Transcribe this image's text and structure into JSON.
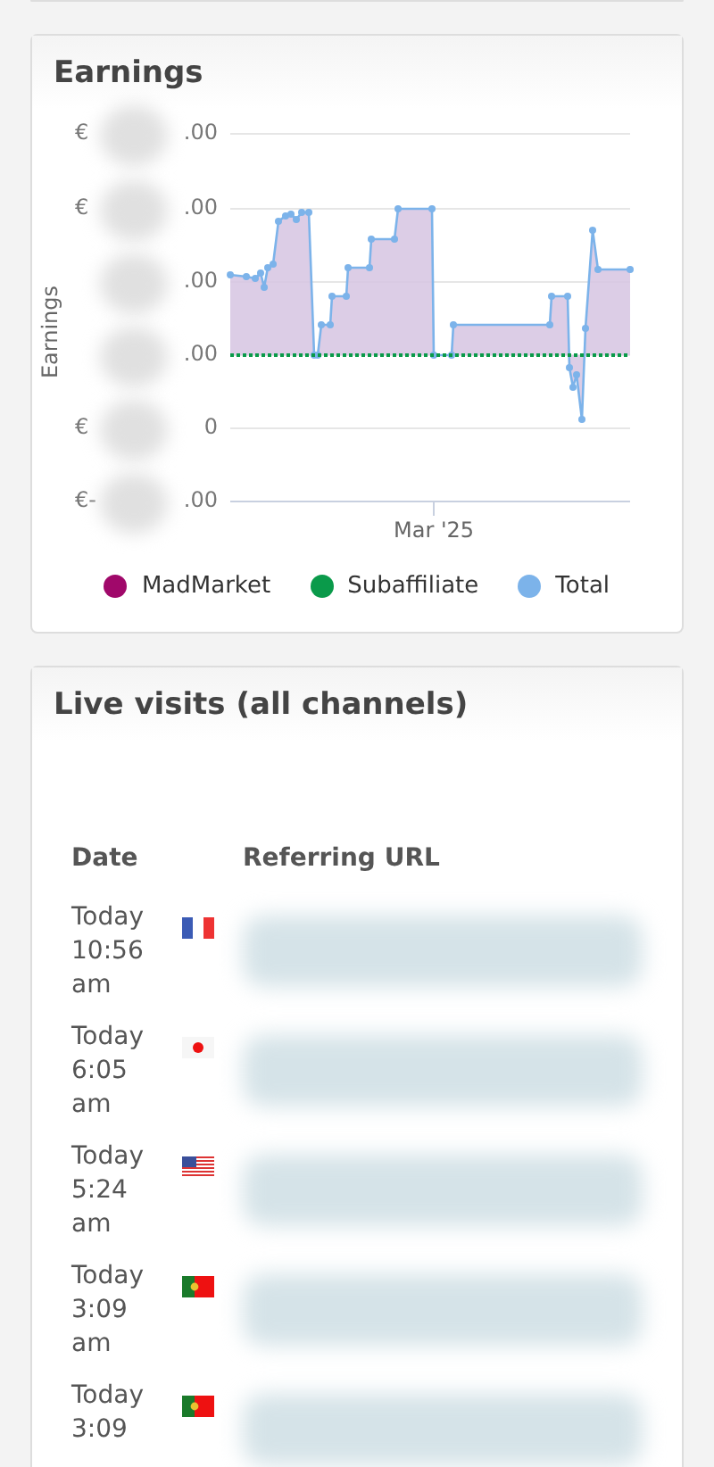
{
  "earnings": {
    "title": "Earnings",
    "ylabel": "Earnings",
    "y_labels": [
      {
        "prefix": "€",
        "suffix": ".00"
      },
      {
        "prefix": "€",
        "suffix": ".00"
      },
      {
        "suffix": ".00"
      },
      {
        "suffix": ".00"
      },
      {
        "prefix": "€",
        "suffix": "0"
      },
      {
        "prefix": "€-",
        "suffix": ".00"
      }
    ],
    "x_label": "Mar '25",
    "legend": [
      {
        "label": "MadMarket",
        "color": "#a0086a"
      },
      {
        "label": "Subaffiliate",
        "color": "#0a9a4a"
      },
      {
        "label": "Total",
        "color": "#7cb3ea"
      }
    ]
  },
  "live_visits": {
    "title": "Live visits (all channels)",
    "columns": [
      "Date",
      "Referring URL"
    ],
    "rows": [
      {
        "date": "Today 10:56 am",
        "kind": "france"
      },
      {
        "date": "Today 6:05 am",
        "kind": "japan"
      },
      {
        "date": "Today 5:24 am",
        "kind": "usa"
      },
      {
        "date": "Today 3:09 am",
        "kind": "portugal"
      },
      {
        "date": "Today 3:09",
        "kind": "portugal"
      }
    ]
  }
}
